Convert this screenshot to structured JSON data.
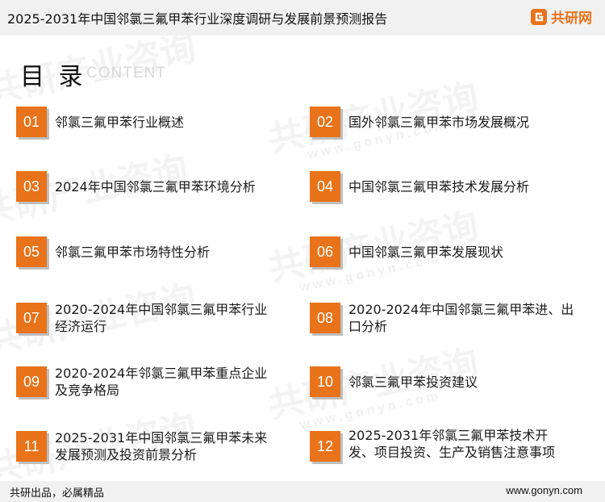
{
  "header": {
    "title": "2025-2031年中国邻氯三氟甲苯行业深度调研与发展前景预测报告",
    "brand": "共研网"
  },
  "toc": {
    "heading": "目 录",
    "subheading": "CONTENT",
    "items": [
      {
        "num": "01",
        "label": "邻氯三氟甲苯行业概述"
      },
      {
        "num": "02",
        "label": "国外邻氯三氟甲苯市场发展概况"
      },
      {
        "num": "03",
        "label": "2024年中国邻氯三氟甲苯环境分析"
      },
      {
        "num": "04",
        "label": "中国邻氯三氟甲苯技术发展分析"
      },
      {
        "num": "05",
        "label": "邻氯三氟甲苯市场特性分析"
      },
      {
        "num": "06",
        "label": "中国邻氯三氟甲苯发展现状"
      },
      {
        "num": "07",
        "label": "2020-2024年中国邻氯三氟甲苯行业经济运行"
      },
      {
        "num": "08",
        "label": "2020-2024年中国邻氯三氟甲苯进、出口分析"
      },
      {
        "num": "09",
        "label": "2020-2024年邻氯三氟甲苯重点企业及竞争格局"
      },
      {
        "num": "10",
        "label": "邻氯三氟甲苯投资建议"
      },
      {
        "num": "11",
        "label": "2025-2031年中国邻氯三氟甲苯未来发展预测及投资前景分析"
      },
      {
        "num": "12",
        "label": "2025-2031年邻氯三氟甲苯技术开发、项目投资、生产及销售注意事项"
      }
    ]
  },
  "watermark": {
    "text": "共研产业咨询",
    "url": "www.gonyn.com"
  },
  "footer": {
    "slogan": "共研出品，必属精品",
    "url": "www.gonyn.com"
  },
  "colors": {
    "accent": "#e8731a",
    "bar": "#f1f1f1"
  }
}
